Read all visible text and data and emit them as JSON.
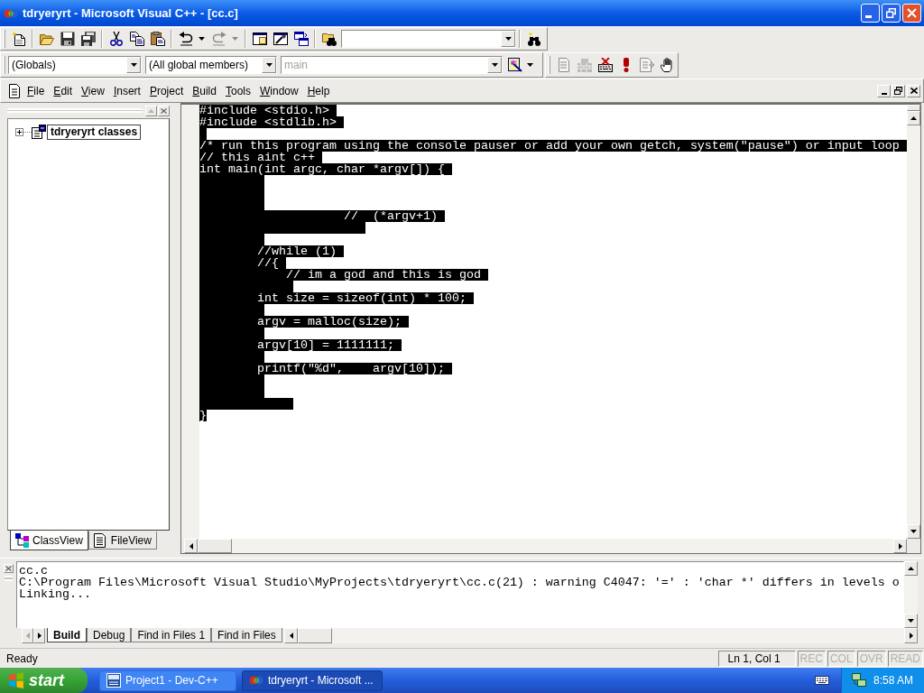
{
  "window": {
    "title": "tdryeryrt - Microsoft Visual C++ - [cc.c]"
  },
  "standard_toolbar": [
    {
      "disabled": false
    },
    {
      "disabled": false
    },
    {
      "disabled": false
    },
    {
      "disabled": false
    },
    {
      "disabled": false
    },
    {
      "disabled": false
    },
    {
      "disabled": false
    },
    {
      "disabled": false
    },
    {
      "disabled": true
    },
    {
      "disabled": false
    },
    {
      "disabled": false
    },
    {
      "disabled": false
    },
    {
      "disabled": false
    },
    {
      "disabled": false
    }
  ],
  "wizard_bar": {
    "combos": [
      {
        "value": "(Globals)",
        "disabled": false
      },
      {
        "value": "(All global members)",
        "disabled": false
      },
      {
        "value": "main",
        "disabled": true
      }
    ]
  },
  "build_toolbar": [
    {
      "disabled": true
    },
    {
      "disabled": true
    },
    {
      "disabled": false
    },
    {
      "disabled": false
    },
    {
      "disabled": true
    },
    {
      "disabled": false
    }
  ],
  "menu_bar": [
    "File",
    "Edit",
    "View",
    "Insert",
    "Project",
    "Build",
    "Tools",
    "Window",
    "Help"
  ],
  "workspace": {
    "tree": [
      {
        "label": "tdryeryrt classes",
        "expanded": false,
        "selected": true
      }
    ],
    "tabs": [
      {
        "label": "ClassView",
        "selected": true
      },
      {
        "label": "FileView",
        "selected": false
      }
    ]
  },
  "editor": {
    "selected": true,
    "code": "#include <stdio.h>\n#include <stdlib.h>\n\n/* run this program using the console pauser or add your own getch, system(\"pause\") or input loop\n// this aint c++\nint main(int argc, char *argv[]) {\n\t\t\n\t\t\n\t\t\n\t\t\t\t\t//\t(*argv+1)\n\t\t\t\t\t  \n\t\t\n\t\t//while (1)\n\t\t//{\n\t\t\t// im a god and this is god\n\t\t\t\n\t\tint size = sizeof(int) * 100;\n\t\t\n\t\targv = malloc(size);\n\t\t\n\t\targv[10] = 1111111;\n\t\t\n\t\tprintf(\"%d\",\targv[10]);\n\t\t\n\t\t\n\t\t\t\n}"
  },
  "output": {
    "lines": [
      "cc.c",
      "C:\\Program Files\\Microsoft Visual Studio\\MyProjects\\tdryeryrt\\cc.c(21) : warning C4047: '=' : 'char *' differs in levels o",
      "Linking..."
    ],
    "tabs": [
      {
        "label": "Build",
        "selected": true
      },
      {
        "label": "Debug",
        "selected": false
      },
      {
        "label": "Find in Files 1",
        "selected": false
      },
      {
        "label": "Find in Files",
        "selected": false
      }
    ]
  },
  "status_bar": {
    "message": "Ready",
    "position": "Ln 1, Col 1",
    "indicators": [
      {
        "label": "REC",
        "on": false
      },
      {
        "label": "COL",
        "on": false
      },
      {
        "label": "OVR",
        "on": false
      },
      {
        "label": "READ",
        "on": false
      }
    ]
  },
  "taskbar": {
    "start": "start",
    "tasks": [
      {
        "label": "Project1 - Dev-C++",
        "selected": false
      },
      {
        "label": "tdryeryrt - Microsoft ...",
        "selected": true
      }
    ],
    "clock": "8:58 AM"
  }
}
